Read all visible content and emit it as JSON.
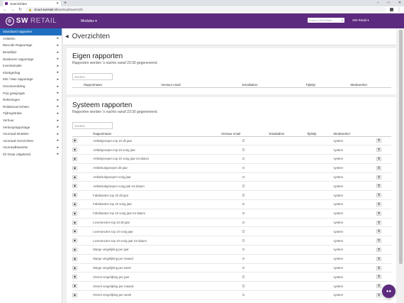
{
  "browser": {
    "tab_title": "Overzichten",
    "new_tab": "+",
    "url_host": "cloud.swretail.nl",
    "url_path": "/swcloud/overzicht",
    "win_min": "–",
    "win_max": "□",
    "win_close": "✕"
  },
  "topbar": {
    "logo_text": "SW",
    "logo_text2": "RETAIL",
    "modules": "Modules ▾",
    "search_placeholder": "Zoek in SW-Retail",
    "user": "SW Retail ▾"
  },
  "sidebar": {
    "items": [
      {
        "label": "Standaard rapporten",
        "active": true,
        "arrow": ""
      },
      {
        "label": "Artikelen",
        "arrow": "▸"
      },
      {
        "label": "Barcode Rapportage",
        "arrow": "▸"
      },
      {
        "label": "Bestellijst",
        "arrow": "▸"
      },
      {
        "label": "Diasboren rapportage",
        "arrow": "▸"
      },
      {
        "label": "Inventarisatie",
        "arrow": "▸"
      },
      {
        "label": "Klantgedrag",
        "arrow": "▸"
      },
      {
        "label": "Min / Max rapportage",
        "arrow": "▸"
      },
      {
        "label": "Omzetverdeling",
        "arrow": "▸"
      },
      {
        "label": "Prijs gewijzigde",
        "arrow": "▸"
      },
      {
        "label": "Rekeningen",
        "arrow": "▸"
      },
      {
        "label": "Relatieoverzichten",
        "arrow": "▸"
      },
      {
        "label": "Tijdregistratie",
        "arrow": "▸"
      },
      {
        "label": "Verhuur",
        "arrow": "▸"
      },
      {
        "label": "Verkooprapportage",
        "arrow": "▸"
      },
      {
        "label": "Voorraad Mutaties",
        "arrow": "▸"
      },
      {
        "label": "Voorraad Overzichten",
        "arrow": "▸"
      },
      {
        "label": "Voorraadbewerke",
        "arrow": "▸"
      },
      {
        "label": "Z/I Draai Uitgebreid",
        "arrow": "▸"
      }
    ]
  },
  "page": {
    "title": "Overzichten",
    "menu_icon": "◀"
  },
  "eigen": {
    "title": "Eigen rapporten",
    "subtitle": "Rapporten worden 's nachts vanaf 23:30 gegenereerd.",
    "search_placeholder": "Zoeken",
    "headers": [
      "",
      "Rapportnaam",
      "Verstuur email",
      "Emailadres",
      "Tijdstip",
      "Medewerker"
    ]
  },
  "systeem": {
    "title": "Systeem rapporten",
    "subtitle": "Rapporten worden 's nachts vanaf 23:30 gegenereerd.",
    "search_placeholder": "Zoeken",
    "headers": [
      "",
      "Rapportnaam",
      "Verstuur email",
      "Emailadres",
      "Tijdstip",
      "Medewerker",
      ""
    ],
    "rows": [
      {
        "name": "Artikelgroepen top 10 dit jaar",
        "user": "system"
      },
      {
        "name": "Artikelgroepen top 10 vorig jaar",
        "user": "system"
      },
      {
        "name": "Artikelgroepen top 10 vorig jaar tot datum",
        "user": "system"
      },
      {
        "name": "Artikelsubgroepen dit jaar",
        "user": "system"
      },
      {
        "name": "Artikelsubgroepen vorig jaar",
        "user": "system"
      },
      {
        "name": "Artikelsubgroepen vorig jaar tot datum",
        "user": "system"
      },
      {
        "name": "Fabrikanten top 10 dit jaar",
        "user": "system"
      },
      {
        "name": "Fabrikanten top 10 vorig jaar",
        "user": "system"
      },
      {
        "name": "Fabrikanten top 10 vorig jaar tot datum",
        "user": "system"
      },
      {
        "name": "Leveranciers top 10 dit jaar",
        "user": "system"
      },
      {
        "name": "Leveranciers top 10 vorig jaar",
        "user": "system"
      },
      {
        "name": "Leveranciers top 10 vorig jaar tot datum",
        "user": "system"
      },
      {
        "name": "Marge vergelijking per jaar",
        "user": "system"
      },
      {
        "name": "Marge vergelijking per maand",
        "user": "system"
      },
      {
        "name": "Marge vergelijking per week",
        "user": "system"
      },
      {
        "name": "Omzet vergelijking per jaar",
        "user": "system"
      },
      {
        "name": "Omzet vergelijking per maand",
        "user": "system"
      },
      {
        "name": "Omzet vergelijking per week",
        "user": "system"
      }
    ]
  },
  "icons": {
    "eye": "◉",
    "copy": "⧉",
    "chat": "●●"
  }
}
